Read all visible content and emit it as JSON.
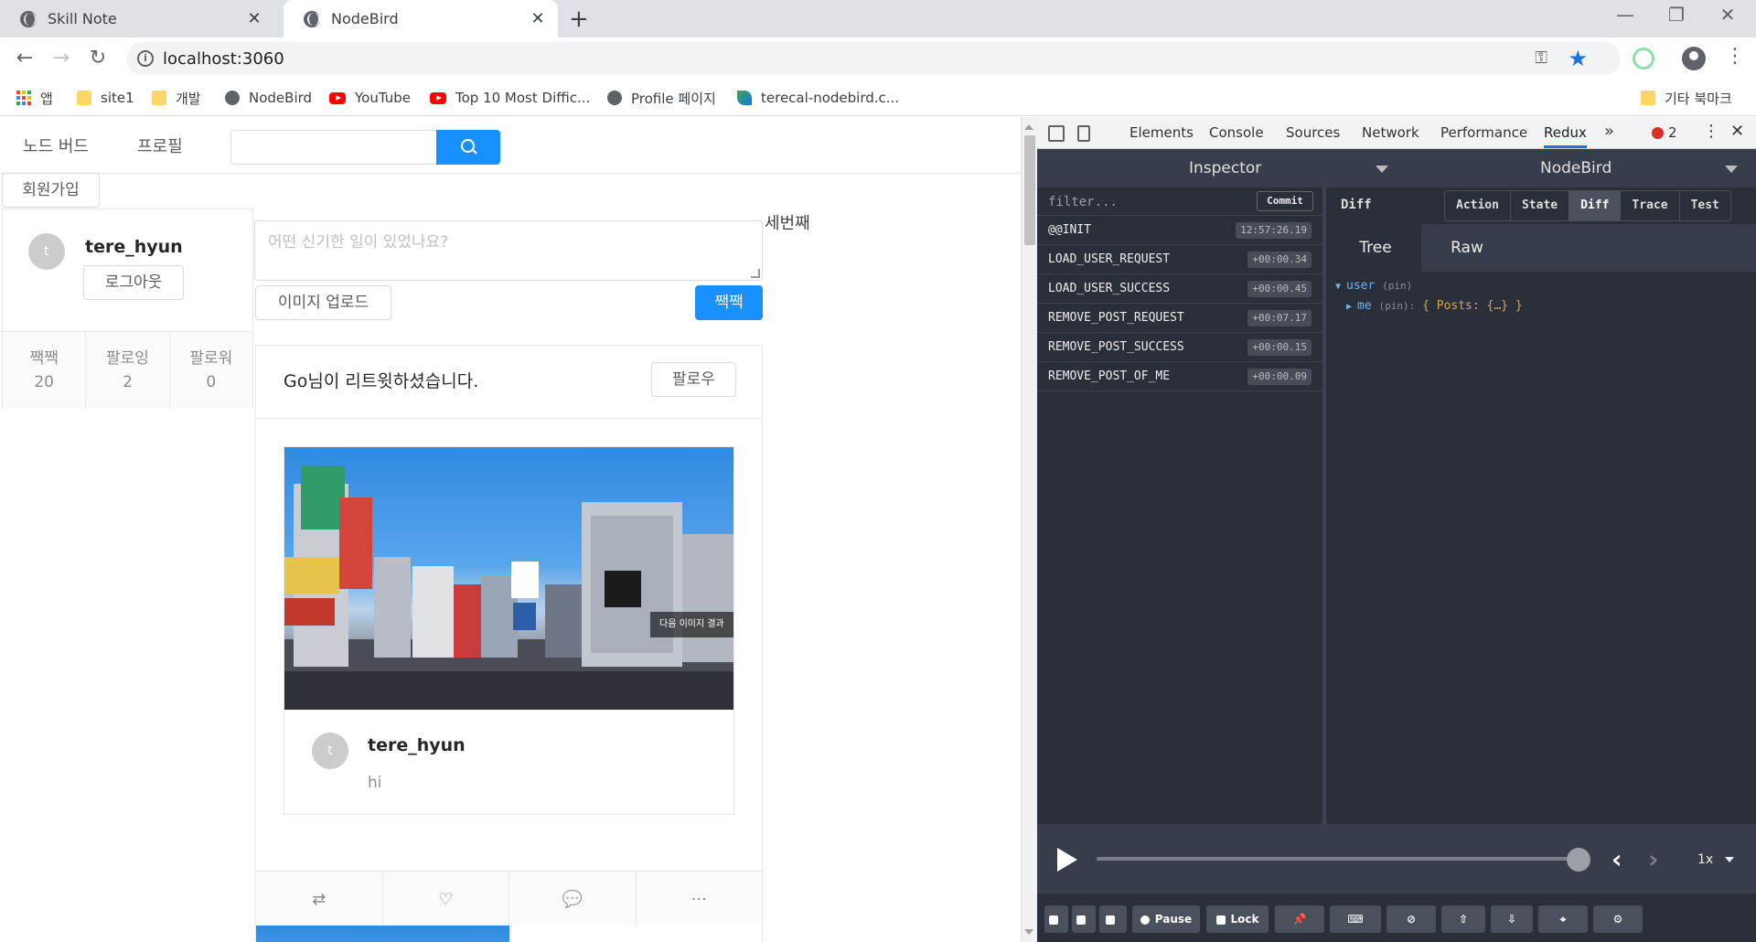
{
  "browser": {
    "tabs": [
      {
        "title": "Skill Note",
        "close": "✕"
      },
      {
        "title": "NodeBird",
        "close": "✕"
      }
    ],
    "new_tab": "+",
    "window": {
      "minimize": "—",
      "maximize": "❐",
      "close": "✕"
    },
    "nav": {
      "back": "←",
      "forward": "→",
      "reload": "↻"
    },
    "url": "localhost:3060",
    "bookmarks": [
      "앱",
      "site1",
      "개발",
      "NodeBird",
      "YouTube",
      "Top 10 Most Diffic...",
      "Profile 페이지",
      "terecal-nodebird.c...",
      "기타 북마크"
    ]
  },
  "app": {
    "menu": {
      "home": "노드 버드",
      "profile": "프로필"
    },
    "signup": "회원가입",
    "profile_card": {
      "avatar": "t",
      "nickname": "tere_hyun",
      "logout": "로그아웃",
      "stats": [
        {
          "label": "짹짹",
          "value": "20"
        },
        {
          "label": "팔로잉",
          "value": "2"
        },
        {
          "label": "팔로워",
          "value": "0"
        }
      ]
    },
    "post_form": {
      "placeholder": "어떤 신기한 일이 있었나요?",
      "side_text": "세번째",
      "upload": "이미지 업로드",
      "submit": "짹짹"
    },
    "post": {
      "retweet_text": "Go님이 리트윗하셨습니다.",
      "follow": "팔로우",
      "photo_overlay": "다음 이미지 결과",
      "avatar": "t",
      "author": "tere_hyun",
      "content": "hi",
      "actions": {
        "retweet": "⇄",
        "like": "♡",
        "comment": "💬",
        "more": "···"
      }
    }
  },
  "devtools": {
    "tabs": [
      "Elements",
      "Console",
      "Sources",
      "Network",
      "Performance",
      "Redux"
    ],
    "active_tab": "Redux",
    "more": "»",
    "error_count": "2",
    "redux": {
      "monitor": "Inspector",
      "store": "NodeBird",
      "filter_placeholder": "filter...",
      "commit": "Commit",
      "actions": [
        {
          "name": "@@INIT",
          "time": "12:57:26.19"
        },
        {
          "name": "LOAD_USER_REQUEST",
          "time": "+00:00.34"
        },
        {
          "name": "LOAD_USER_SUCCESS",
          "time": "+00:00.45"
        },
        {
          "name": "REMOVE_POST_REQUEST",
          "time": "+00:07.17"
        },
        {
          "name": "REMOVE_POST_SUCCESS",
          "time": "+00:00.15"
        },
        {
          "name": "REMOVE_POST_OF_ME",
          "time": "+00:00.09"
        }
      ],
      "diff_label": "Diff",
      "view_tabs": [
        "Action",
        "State",
        "Diff",
        "Trace",
        "Test"
      ],
      "active_view": "Diff",
      "format_tabs": [
        "Tree",
        "Raw"
      ],
      "tree": {
        "root_key": "user",
        "root_pin": "(pin)",
        "child_key": "me",
        "child_pin": "(pin):",
        "child_value": "{ Posts: {…} }"
      },
      "speed": "1x",
      "bottom_buttons": {
        "pause": "Pause",
        "lock": "Lock"
      }
    }
  }
}
